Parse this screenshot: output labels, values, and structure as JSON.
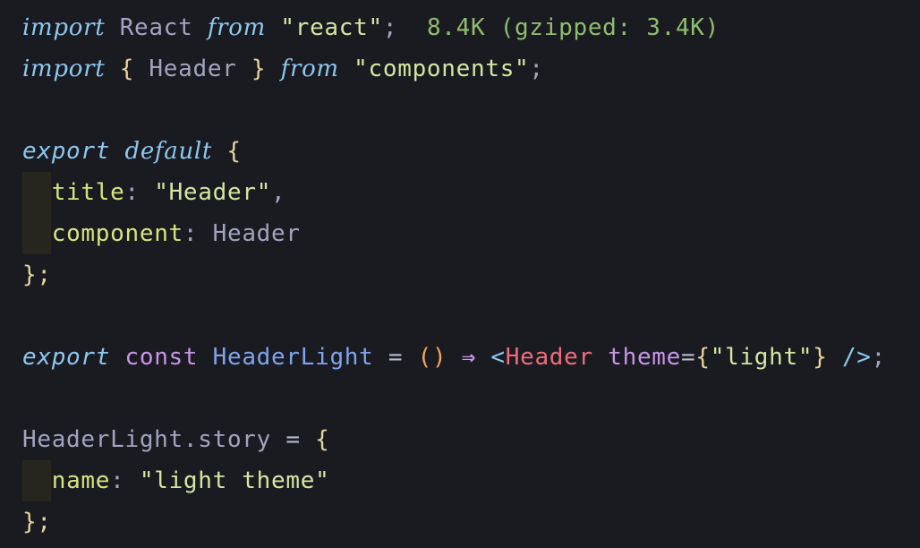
{
  "editor": {
    "line1": {
      "import_kw": "import",
      "ident": "React",
      "from_kw": "from",
      "source": "\"react\"",
      "semi": ";",
      "size_hint": "8.4K (gzipped: 3.4K)"
    },
    "line2": {
      "import_kw": "import",
      "open_brace": "{",
      "ident": "Header",
      "close_brace": "}",
      "from_kw": "from",
      "source": "\"components\"",
      "semi": ";"
    },
    "line4": {
      "export_kw": "export",
      "default_kw": "default",
      "open_brace": "{"
    },
    "line5": {
      "prop": "title",
      "colon": ":",
      "value": "\"Header\"",
      "comma": ","
    },
    "line6": {
      "prop": "component",
      "colon": ":",
      "value": "Header"
    },
    "line7": {
      "close": "};"
    },
    "line9": {
      "export_kw": "export",
      "const_kw": "const",
      "name": "HeaderLight",
      "eq": "=",
      "parens": "()",
      "arrow": "⇒",
      "tag_open": "<",
      "tag_name": "Header",
      "attr": "theme",
      "attr_eq": "=",
      "brace_open": "{",
      "attr_value": "\"light\"",
      "brace_close": "}",
      "tag_close": "/>",
      "semi": ";"
    },
    "line11": {
      "target": "HeaderLight.story",
      "eq": "=",
      "open_brace": "{"
    },
    "line12": {
      "prop": "name",
      "colon": ":",
      "value": "\"light theme\""
    },
    "line13": {
      "close": "};"
    }
  }
}
